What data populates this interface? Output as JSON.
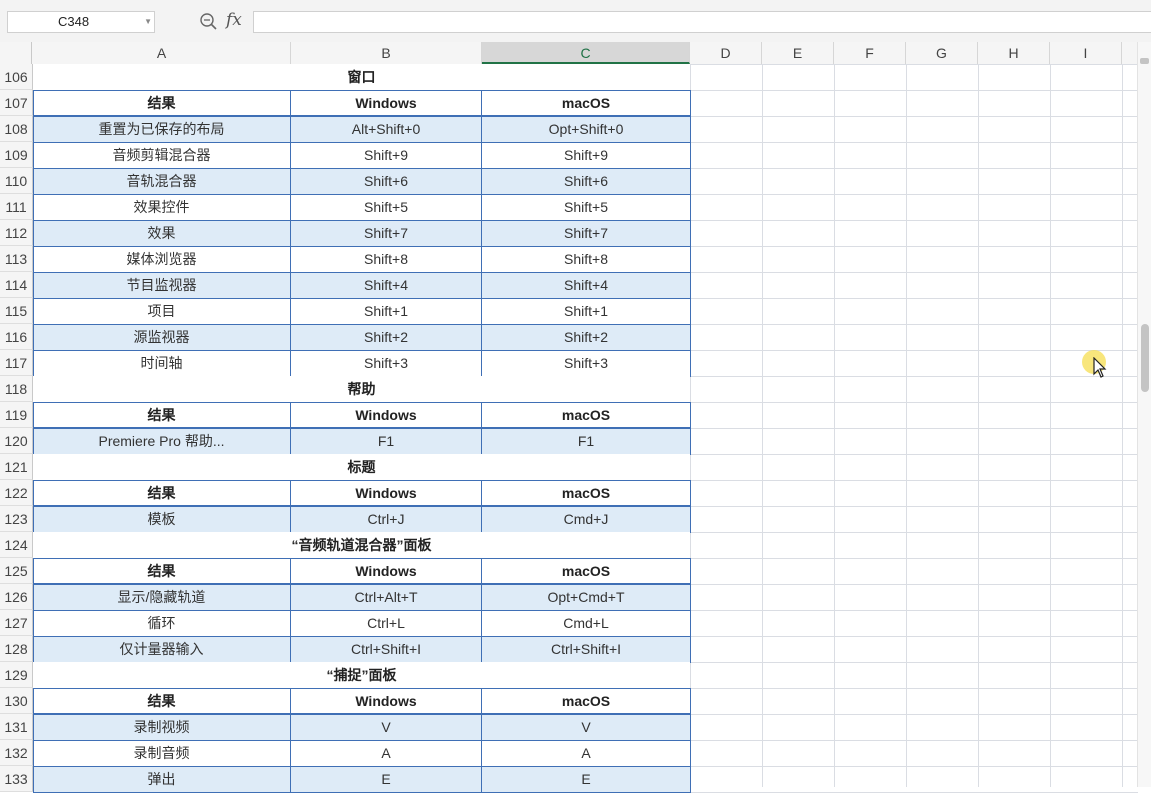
{
  "formula_bar": {
    "name_box": "C348",
    "fx_label": "fx",
    "formula_value": ""
  },
  "columns": [
    "A",
    "B",
    "C",
    "D",
    "E",
    "F",
    "G",
    "H",
    "I"
  ],
  "active_column": "C",
  "rows": [
    {
      "num": "106",
      "type": "title",
      "text": "窗口"
    },
    {
      "num": "107",
      "type": "header",
      "cells": [
        "结果",
        "Windows",
        "macOS"
      ]
    },
    {
      "num": "108",
      "type": "data",
      "band": "blue",
      "cells": [
        "重置为已保存的布局",
        "Alt+Shift+0",
        "Opt+Shift+0"
      ]
    },
    {
      "num": "109",
      "type": "data",
      "band": "white",
      "cells": [
        "音频剪辑混合器",
        "Shift+9",
        "Shift+9"
      ]
    },
    {
      "num": "110",
      "type": "data",
      "band": "blue",
      "cells": [
        "音轨混合器",
        "Shift+6",
        "Shift+6"
      ]
    },
    {
      "num": "111",
      "type": "data",
      "band": "white",
      "cells": [
        "效果控件",
        "Shift+5",
        "Shift+5"
      ]
    },
    {
      "num": "112",
      "type": "data",
      "band": "blue",
      "cells": [
        "效果",
        "Shift+7",
        "Shift+7"
      ]
    },
    {
      "num": "113",
      "type": "data",
      "band": "white",
      "cells": [
        "媒体浏览器",
        "Shift+8",
        "Shift+8"
      ]
    },
    {
      "num": "114",
      "type": "data",
      "band": "blue",
      "cells": [
        "节目监视器",
        "Shift+4",
        "Shift+4"
      ]
    },
    {
      "num": "115",
      "type": "data",
      "band": "white",
      "cells": [
        "项目",
        "Shift+1",
        "Shift+1"
      ]
    },
    {
      "num": "116",
      "type": "data",
      "band": "blue",
      "cells": [
        "源监视器",
        "Shift+2",
        "Shift+2"
      ]
    },
    {
      "num": "117",
      "type": "data",
      "band": "white",
      "cells": [
        "时间轴",
        "Shift+3",
        "Shift+3"
      ]
    },
    {
      "num": "118",
      "type": "title",
      "text": "帮助"
    },
    {
      "num": "119",
      "type": "header",
      "cells": [
        "结果",
        "Windows",
        "macOS"
      ]
    },
    {
      "num": "120",
      "type": "data",
      "band": "blue",
      "cells": [
        "Premiere Pro 帮助...",
        "F1",
        "F1"
      ]
    },
    {
      "num": "121",
      "type": "title",
      "text": "标题"
    },
    {
      "num": "122",
      "type": "header",
      "cells": [
        "结果",
        "Windows",
        "macOS"
      ]
    },
    {
      "num": "123",
      "type": "data",
      "band": "blue",
      "cells": [
        "模板",
        "Ctrl+J",
        "Cmd+J"
      ]
    },
    {
      "num": "124",
      "type": "title",
      "text": "“音频轨道混合器”面板"
    },
    {
      "num": "125",
      "type": "header",
      "cells": [
        "结果",
        "Windows",
        "macOS"
      ]
    },
    {
      "num": "126",
      "type": "data",
      "band": "blue",
      "cells": [
        "显示/隐藏轨道",
        "Ctrl+Alt+T",
        "Opt+Cmd+T"
      ]
    },
    {
      "num": "127",
      "type": "data",
      "band": "white",
      "cells": [
        "循环",
        "Ctrl+L",
        "Cmd+L"
      ]
    },
    {
      "num": "128",
      "type": "data",
      "band": "blue",
      "cells": [
        "仅计量器输入",
        "Ctrl+Shift+I",
        "Ctrl+Shift+I"
      ]
    },
    {
      "num": "129",
      "type": "title",
      "text": "“捕捉”面板"
    },
    {
      "num": "130",
      "type": "header",
      "cells": [
        "结果",
        "Windows",
        "macOS"
      ]
    },
    {
      "num": "131",
      "type": "data",
      "band": "blue",
      "cells": [
        "录制视频",
        "V",
        "V"
      ]
    },
    {
      "num": "132",
      "type": "data",
      "band": "white",
      "cells": [
        "录制音频",
        "A",
        "A"
      ]
    },
    {
      "num": "133",
      "type": "data",
      "band": "blue",
      "cells": [
        "弹出",
        "E",
        "E"
      ]
    }
  ],
  "icons": {
    "zoom": "zoom-formula-icon",
    "fx": "function-icon",
    "cursor": "mouse-pointer-icon"
  },
  "colors": {
    "table_border": "#3f6fb5",
    "band_blue": "#deebf7",
    "active_col_text": "#1e7145"
  }
}
